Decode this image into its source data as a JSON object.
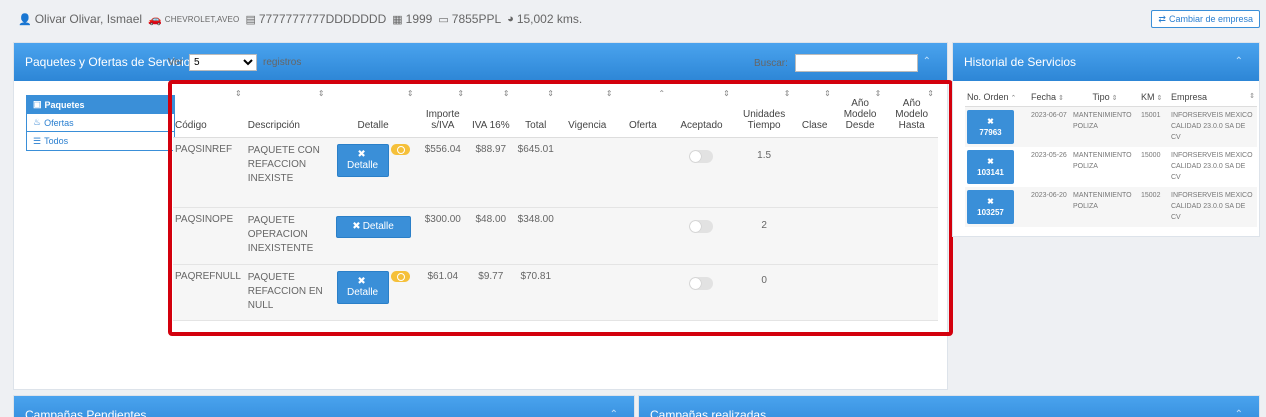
{
  "header": {
    "cliente": "Olivar Olivar, Ismael",
    "vehiculo": "CHEVROLET,AVEO",
    "vin": "7777777777DDDDDDD",
    "anio": "1999",
    "placas": "7855PPL",
    "km": "15,002 kms.",
    "cambiar_empresa": "Cambiar de empresa"
  },
  "panels": {
    "paquetes_title": "Paquetes y Ofertas de Servicios",
    "historial_title": "Historial de Servicios",
    "pendientes_title": "Campañas Pendientes",
    "realizadas_title": "Campañas realizadas"
  },
  "nav": {
    "paquetes": "Paquetes",
    "ofertas": "Ofertas",
    "todos": "Todos"
  },
  "controls": {
    "ver_label": "Ver",
    "ver_value": "5",
    "registros_label": "registros",
    "buscar_label": "Buscar:"
  },
  "table": {
    "headers": {
      "codigo": "Código",
      "descripcion": "Descripción",
      "detalle": "Detalle",
      "importe": "Importe s/IVA",
      "iva": "IVA 16%",
      "total": "Total",
      "vigencia": "Vigencia",
      "oferta": "Oferta",
      "aceptado": "Aceptado",
      "unidades": "Unidades Tiempo",
      "clase": "Clase",
      "anio_desde": "Año Modelo Desde",
      "anio_hasta": "Año Modelo Hasta"
    },
    "detalle_label": "Detalle",
    "rows": [
      {
        "codigo": "PAQSINREF",
        "descripcion": "PAQUETE CON REFACCION INEXISTE",
        "importe": "$556.04",
        "iva": "$88.97",
        "total": "$645.01",
        "unidades": "1.5"
      },
      {
        "codigo": "PAQSINOPE",
        "descripcion": "PAQUETE OPERACION INEXISTENTE",
        "importe": "$300.00",
        "iva": "$48.00",
        "total": "$348.00",
        "unidades": "2"
      },
      {
        "codigo": "PAQREFNULL",
        "descripcion": "PAQUETE REFACCION EN NULL",
        "importe": "$61.04",
        "iva": "$9.77",
        "total": "$70.81",
        "unidades": "0"
      }
    ]
  },
  "historial": {
    "headers": {
      "orden": "No. Orden",
      "fecha": "Fecha",
      "tipo": "Tipo",
      "km": "KM",
      "empresa": "Empresa"
    },
    "rows": [
      {
        "orden": "77963",
        "fecha": "2023-06-07",
        "tipo": "MANTENIMIENTO POLIZA",
        "km": "15001",
        "empresa": "INFORSERVEIS MEXICO CALIDAD 23.0.0 SA DE CV"
      },
      {
        "orden": "103141",
        "fecha": "2023-05-26",
        "tipo": "MANTENIMIENTO POLIZA",
        "km": "15000",
        "empresa": "INFORSERVEIS MEXICO CALIDAD 23.0.0 SA DE CV"
      },
      {
        "orden": "103257",
        "fecha": "2023-06-20",
        "tipo": "MANTENIMIENTO POLIZA",
        "km": "15002",
        "empresa": "INFORSERVEIS MEXICO CALIDAD 23.0.0 SA DE CV"
      }
    ]
  }
}
